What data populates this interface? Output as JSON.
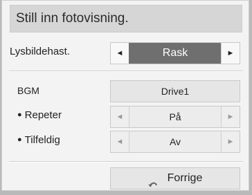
{
  "dialog": {
    "title": "Still inn fotovisning."
  },
  "settings": {
    "slide_speed": {
      "label": "Lysbildehast.",
      "value": "Rask",
      "left_arrow": "◄",
      "right_arrow": "►"
    },
    "bgm": {
      "label": "BGM",
      "value": "Drive1"
    },
    "repeat": {
      "bullet": "●",
      "label": "Repeter",
      "value": "På",
      "left_arrow": "◄",
      "right_arrow": "►"
    },
    "random": {
      "bullet": "●",
      "label": "Tilfeldig",
      "value": "Av",
      "left_arrow": "◄",
      "right_arrow": "►"
    }
  },
  "footer": {
    "back_label": "Forrige",
    "back_icon": "return-arrow-icon"
  }
}
